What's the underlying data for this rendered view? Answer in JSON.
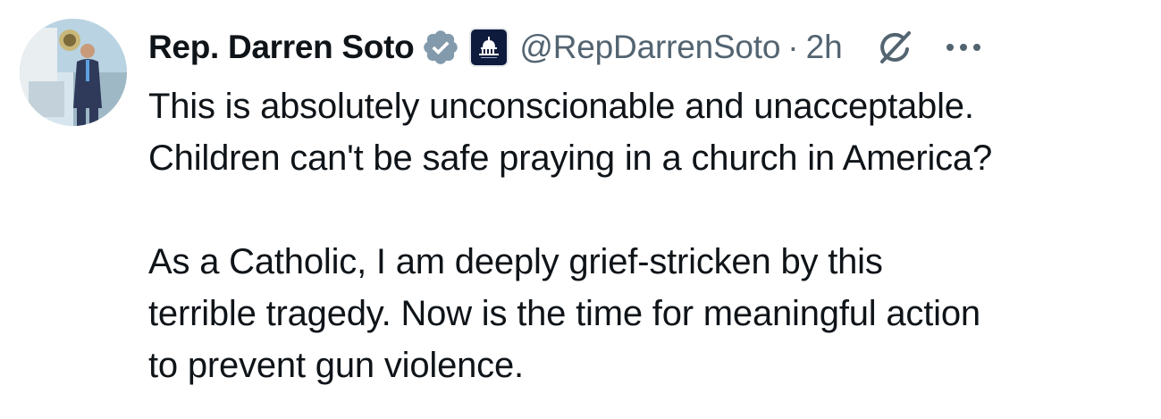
{
  "author": {
    "display_name": "Rep. Darren Soto",
    "handle": "@RepDarrenSoto",
    "separator": "·",
    "timestamp": "2h",
    "verified_badge_icon": "verified-badge-icon",
    "affiliation_badge_icon": "capitol-dome-icon"
  },
  "actions": {
    "grok_icon": "grok-icon",
    "more_icon": "more-dots-icon"
  },
  "tweet": {
    "paragraphs": [
      {
        "lines": [
          "This is absolutely unconscionable and unacceptable.",
          "Children can't be safe praying in a church in America?"
        ]
      },
      {
        "lines": [
          "As a Catholic, I am deeply grief-stricken by this",
          "terrible tragedy. Now is the time for meaningful action",
          "to prevent gun violence."
        ]
      }
    ]
  },
  "colors": {
    "text_primary": "#0f1419",
    "text_secondary": "#536471",
    "verified_blue": "#829aab",
    "affiliate_bg": "#0f1b3d"
  }
}
